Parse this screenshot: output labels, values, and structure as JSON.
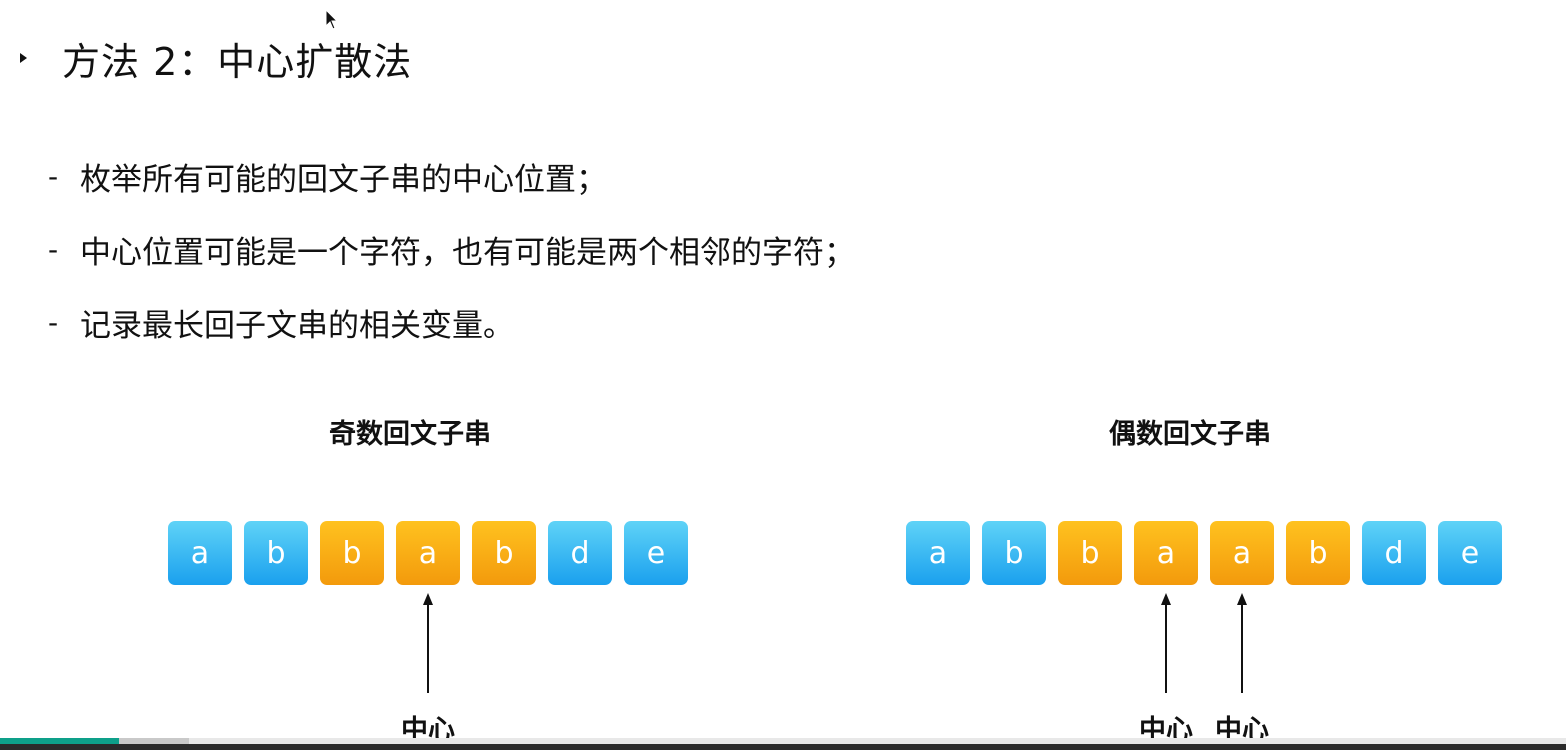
{
  "slide": {
    "title": "方法 2：中心扩散法",
    "bullets": [
      "枚举所有可能的回文子串的中心位置；",
      "中心位置可能是一个字符，也有可能是两个相邻的字符；",
      "记录最长回子文串的相关变量。"
    ],
    "bullet_marker": "-"
  },
  "odd": {
    "title": "奇数回文子串",
    "cells": [
      {
        "char": "a",
        "color": "blue"
      },
      {
        "char": "b",
        "color": "blue"
      },
      {
        "char": "b",
        "color": "orange"
      },
      {
        "char": "a",
        "color": "orange"
      },
      {
        "char": "b",
        "color": "orange"
      },
      {
        "char": "d",
        "color": "blue"
      },
      {
        "char": "e",
        "color": "blue"
      }
    ],
    "center_indices": [
      3
    ],
    "center_label": "中心"
  },
  "even": {
    "title": "偶数回文子串",
    "cells": [
      {
        "char": "a",
        "color": "blue"
      },
      {
        "char": "b",
        "color": "blue"
      },
      {
        "char": "b",
        "color": "orange"
      },
      {
        "char": "a",
        "color": "orange"
      },
      {
        "char": "a",
        "color": "orange"
      },
      {
        "char": "b",
        "color": "orange"
      },
      {
        "char": "d",
        "color": "blue"
      },
      {
        "char": "e",
        "color": "blue"
      }
    ],
    "center_indices": [
      3,
      4
    ],
    "center_label": "中心"
  },
  "colors": {
    "blue": "#1aa0ee",
    "orange": "#f39a0c",
    "progress": "#0ea08a"
  },
  "video": {
    "progress_fraction": 0.076,
    "buffered_fraction": 0.121
  }
}
